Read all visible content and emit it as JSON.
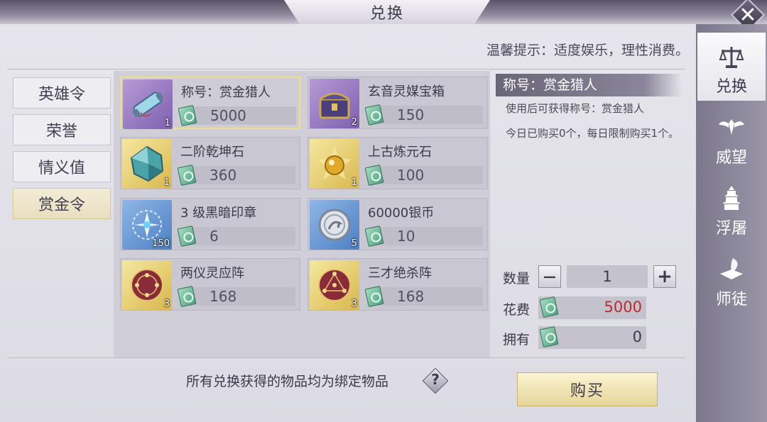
{
  "title": "兑换",
  "tip": "温馨提示：适度娱乐，理性消费。",
  "categories": [
    {
      "label": "英雄令",
      "active": false
    },
    {
      "label": "荣誉",
      "active": false
    },
    {
      "label": "情义值",
      "active": false
    },
    {
      "label": "赏金令",
      "active": true
    }
  ],
  "items": [
    {
      "name": "称号：赏金猎人",
      "price": "5000",
      "qty": "1",
      "icon": "scroll-icon",
      "selected": true
    },
    {
      "name": "玄音灵媒宝箱",
      "price": "150",
      "qty": "2",
      "icon": "treasure-chest-icon",
      "selected": false
    },
    {
      "name": "二阶乾坤石",
      "price": "360",
      "qty": "1",
      "icon": "crystal-stone-icon",
      "selected": false
    },
    {
      "name": "上古炼元石",
      "price": "100",
      "qty": "1",
      "icon": "golden-orb-icon",
      "selected": false
    },
    {
      "name": "3 级黑暗印章",
      "price": "6",
      "qty": "150",
      "icon": "dark-seal-icon",
      "selected": false
    },
    {
      "name": "60000银币",
      "price": "10",
      "qty": "5",
      "icon": "silver-coin-icon",
      "selected": false
    },
    {
      "name": "两仪灵应阵",
      "price": "168",
      "qty": "3",
      "icon": "formation-disc-icon",
      "selected": false
    },
    {
      "name": "三才绝杀阵",
      "price": "168",
      "qty": "3",
      "icon": "formation-disc-icon",
      "selected": false
    }
  ],
  "detail": {
    "title": "称号：赏金猎人",
    "desc": "使用后可获得称号：赏金猎人",
    "limit": "今日已购买0个，每日限制购买1个。"
  },
  "purchase": {
    "qty_label": "数量",
    "qty_value": "1",
    "minus": "—",
    "plus": "+",
    "cost_label": "花费",
    "cost_value": "5000",
    "own_label": "拥有",
    "own_value": "0"
  },
  "bound_note": "所有兑换获得的物品均为绑定物品",
  "help": "?",
  "buy_label": "购买",
  "close": "✕",
  "side_tabs": [
    {
      "label": "兑换",
      "icon": "scales-icon",
      "active": true
    },
    {
      "label": "威望",
      "icon": "winged-emblem-icon",
      "active": false
    },
    {
      "label": "浮屠",
      "icon": "pagoda-icon",
      "active": false
    },
    {
      "label": "师徒",
      "icon": "book-quill-icon",
      "active": false
    }
  ],
  "colors": {
    "cost_text": "#c0282a",
    "tab_active": "#efe5c6",
    "selected_border": "#f1dd86"
  }
}
